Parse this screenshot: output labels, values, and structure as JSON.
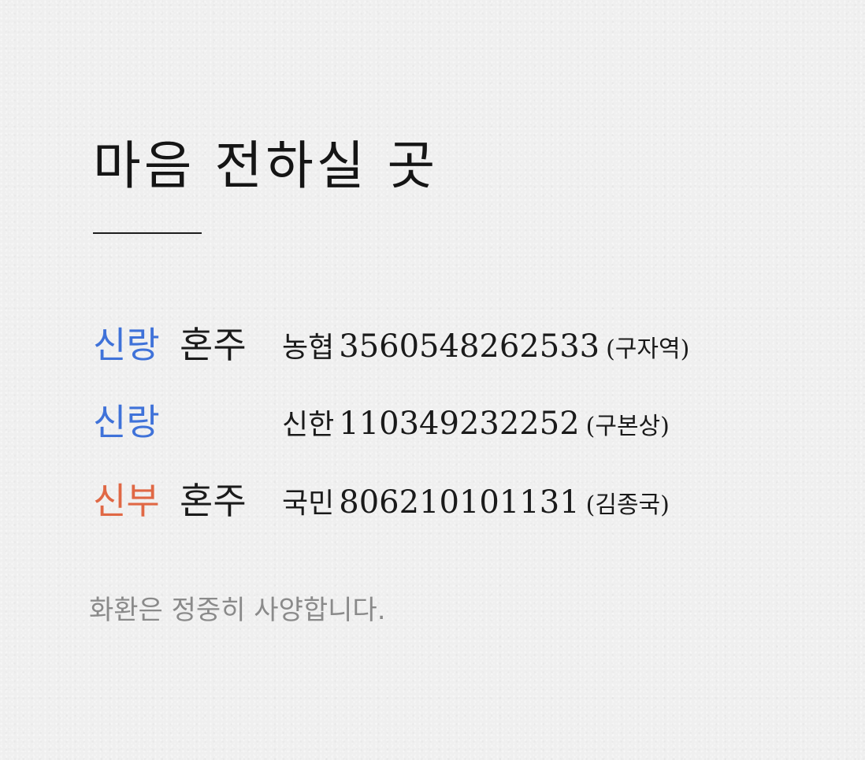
{
  "title": "마음 전하실 곳",
  "accounts": [
    {
      "role": "신랑",
      "holder_label": "혼주",
      "bank": "농협",
      "number": "3560548262533",
      "name": "(구자역)"
    },
    {
      "role": "신랑",
      "holder_label": "",
      "bank": "신한",
      "number": "110349232252",
      "name": "(구본상)"
    },
    {
      "role": "신부",
      "holder_label": "혼주",
      "bank": "국민",
      "number": "806210101131",
      "name": "(김종국)"
    }
  ],
  "note": "화환은 정중히 사양합니다.",
  "colors": {
    "groom": "#3f72d9",
    "bride": "#e06845",
    "text": "#1a1a1a",
    "muted": "#8a8a8a",
    "background": "#efefef"
  }
}
